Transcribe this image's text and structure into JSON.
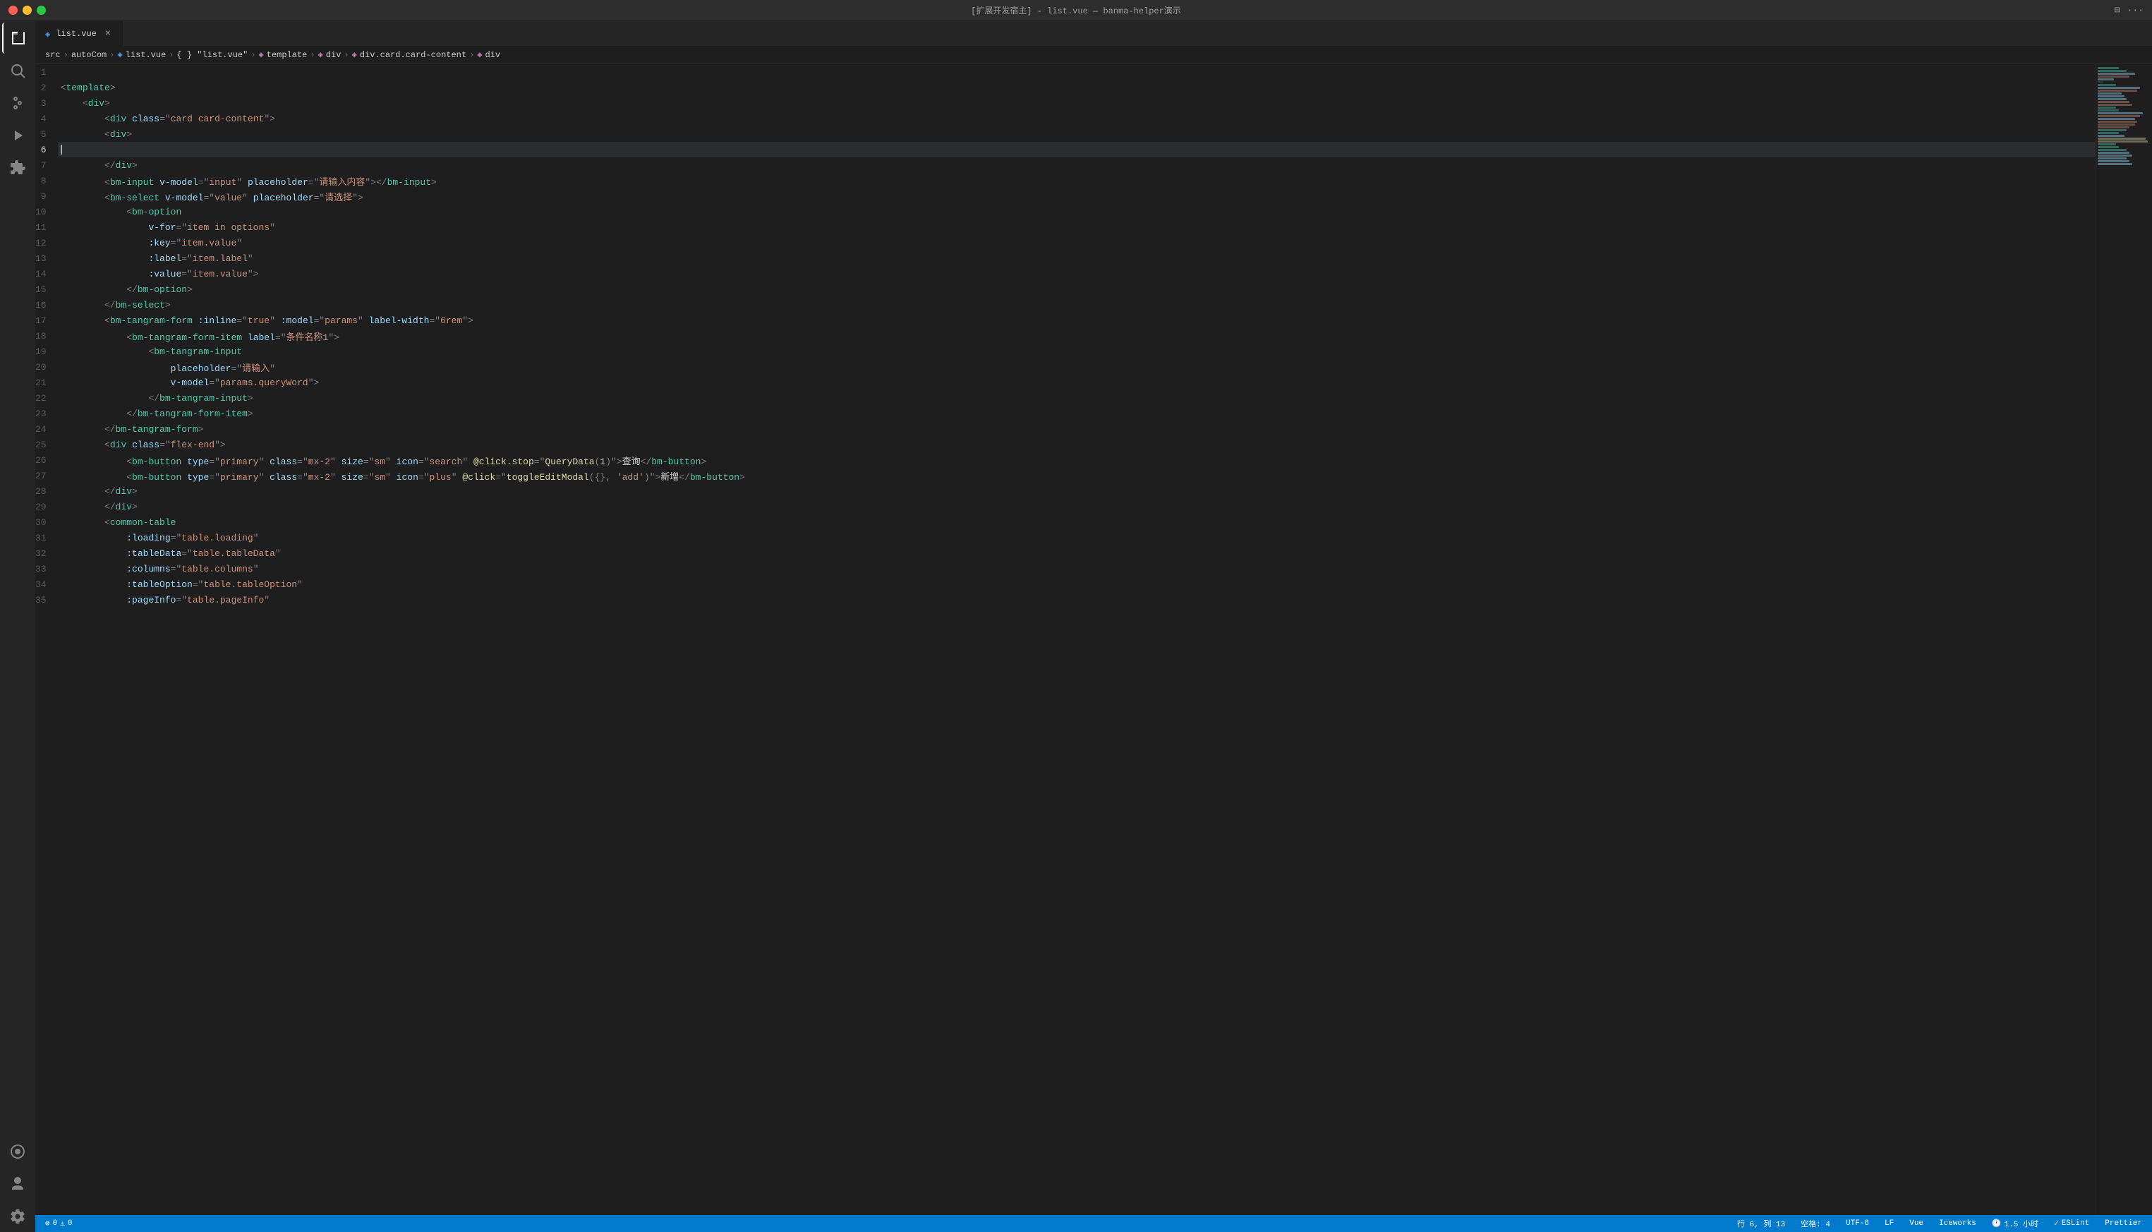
{
  "titleBar": {
    "title": "[扩展开发宿主] - list.vue — banma-helper演示",
    "buttons": {
      "close": "●",
      "min": "●",
      "max": "●"
    }
  },
  "tabs": [
    {
      "id": "list-vue",
      "icon": "◈",
      "label": "list.vue",
      "active": true,
      "modified": false
    }
  ],
  "breadcrumb": {
    "items": [
      "src",
      "autoCom",
      "list.vue",
      "{ } \"list.vue\"",
      "◈ template",
      "◈ div",
      "◈ div.card.card-content",
      "◈ div"
    ]
  },
  "activityBar": {
    "items": [
      {
        "name": "explorer",
        "active": true
      },
      {
        "name": "search"
      },
      {
        "name": "source-control"
      },
      {
        "name": "run"
      },
      {
        "name": "extensions"
      },
      {
        "name": "remote"
      },
      {
        "name": "account"
      },
      {
        "name": "settings"
      }
    ]
  },
  "code": {
    "lines": [
      {
        "num": 1,
        "content": ""
      },
      {
        "num": 2,
        "content": "<template>"
      },
      {
        "num": 3,
        "content": "    <div>"
      },
      {
        "num": 4,
        "content": "        <div class=\"card card-content\">"
      },
      {
        "num": 5,
        "content": "        <div>"
      },
      {
        "num": 6,
        "content": "",
        "active": true
      },
      {
        "num": 7,
        "content": "        </div>"
      },
      {
        "num": 8,
        "content": "        <bm-input v-model=\"input\" placeholder=\"请输入内容\"></bm-input>"
      },
      {
        "num": 9,
        "content": "        <bm-select v-model=\"value\" placeholder=\"请选择\">"
      },
      {
        "num": 10,
        "content": "            <bm-option"
      },
      {
        "num": 11,
        "content": "                v-for=\"item in options\""
      },
      {
        "num": 12,
        "content": "                :key=\"item.value\""
      },
      {
        "num": 13,
        "content": "                :label=\"item.label\""
      },
      {
        "num": 14,
        "content": "                :value=\"item.value\">"
      },
      {
        "num": 15,
        "content": "            </bm-option>"
      },
      {
        "num": 16,
        "content": "        </bm-select>"
      },
      {
        "num": 17,
        "content": "        <bm-tangram-form :inline=\"true\" :model=\"params\" label-width=\"6rem\">"
      },
      {
        "num": 18,
        "content": "            <bm-tangram-form-item label=\"条件名称1\">"
      },
      {
        "num": 19,
        "content": "                <bm-tangram-input"
      },
      {
        "num": 20,
        "content": "                    placeholder=\"请输入\""
      },
      {
        "num": 21,
        "content": "                    v-model=\"params.queryWord\">"
      },
      {
        "num": 22,
        "content": "                </bm-tangram-input>"
      },
      {
        "num": 23,
        "content": "            </bm-tangram-form-item>"
      },
      {
        "num": 24,
        "content": "        </bm-tangram-form>"
      },
      {
        "num": 25,
        "content": "        <div class=\"flex-end\">"
      },
      {
        "num": 26,
        "content": "            <bm-button type=\"primary\" class=\"mx-2\" size=\"sm\" icon=\"search\" @click.stop=\"QueryData(1)\">查询</bm-button>"
      },
      {
        "num": 27,
        "content": "            <bm-button type=\"primary\" class=\"mx-2\" size=\"sm\" icon=\"plus\" @click=\"toggleEditModal({}, 'add')\">新增</bm-button>"
      },
      {
        "num": 28,
        "content": "        </div>"
      },
      {
        "num": 29,
        "content": "        </div>"
      },
      {
        "num": 30,
        "content": "        <common-table"
      },
      {
        "num": 31,
        "content": "            :loading=\"table.loading\""
      },
      {
        "num": 32,
        "content": "            :tableData=\"table.tableData\""
      },
      {
        "num": 33,
        "content": "            :columns=\"table.columns\""
      },
      {
        "num": 34,
        "content": "            :tableOption=\"table.tableOption\""
      },
      {
        "num": 35,
        "content": "            :pageInfo=\"table.pageInfo\""
      }
    ]
  },
  "statusBar": {
    "left": {
      "errors": "0",
      "warnings": "0"
    },
    "right": {
      "position": "行 6, 列 13",
      "spaces": "空格: 4",
      "encoding": "UTF-8",
      "lineEnding": "LF",
      "language": "Vue",
      "theme": "Iceworks",
      "time": "1.5 小时",
      "eslint": "ESLint",
      "prettier": "Prettier"
    }
  }
}
